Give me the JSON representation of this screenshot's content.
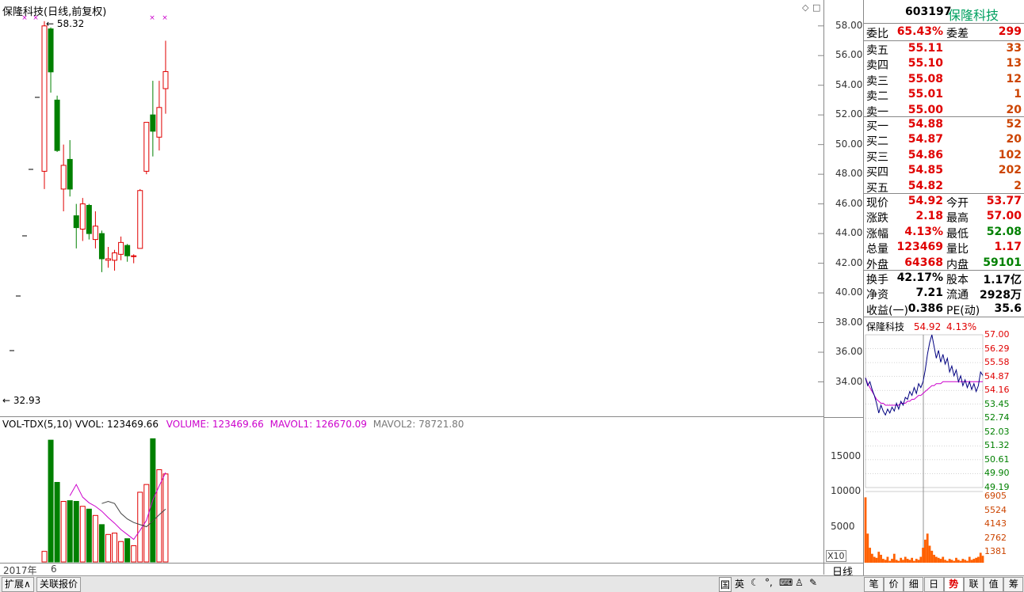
{
  "chart_header": {
    "title": "保隆科技(日线,前复权)",
    "high_marker": "58.32",
    "low_marker": "32.93"
  },
  "price_axis": [
    "58.00",
    "56.00",
    "54.00",
    "52.00",
    "50.00",
    "48.00",
    "46.00",
    "44.00",
    "42.00",
    "40.00",
    "38.00",
    "36.00",
    "34.00"
  ],
  "vol_header": {
    "name": "VOL-TDX(5,10)",
    "vvol": "VVOL: 123469.66",
    "volume": "VOLUME: 123469.66",
    "mavol1": "MAVOL1: 126670.09",
    "mavol2": "MAVOL2: 78721.80"
  },
  "vol_axis": [
    "15000",
    "10000",
    "5000"
  ],
  "vol_unit": "X10",
  "date_axis": {
    "year": "2017年",
    "month": "6"
  },
  "period_label": "日线",
  "colors": {
    "up": "#e00000",
    "down": "#008000",
    "vol_ma1": "#cc00cc",
    "vol_ma2": "#444444",
    "up_text": "#e00000",
    "down_text": "#008000"
  },
  "chart_data": {
    "type": "candlestick",
    "candles": [
      {
        "o": 48.2,
        "h": 58.32,
        "l": 47.0,
        "c": 58.0
      },
      {
        "o": 57.8,
        "h": 57.9,
        "l": 53.5,
        "c": 54.9
      },
      {
        "o": 53.0,
        "h": 53.3,
        "l": 49.5,
        "c": 49.6
      },
      {
        "o": 47.0,
        "h": 50.0,
        "l": 45.5,
        "c": 48.6
      },
      {
        "o": 49.0,
        "h": 50.3,
        "l": 46.5,
        "c": 47.0
      },
      {
        "o": 45.2,
        "h": 46.0,
        "l": 43.0,
        "c": 44.4
      },
      {
        "o": 44.3,
        "h": 46.4,
        "l": 43.5,
        "c": 46.0
      },
      {
        "o": 45.9,
        "h": 46.0,
        "l": 43.6,
        "c": 44.0
      },
      {
        "o": 43.6,
        "h": 45.5,
        "l": 43.0,
        "c": 44.5
      },
      {
        "o": 44.0,
        "h": 44.2,
        "l": 41.4,
        "c": 42.3
      },
      {
        "o": 42.2,
        "h": 43.1,
        "l": 41.7,
        "c": 42.3
      },
      {
        "o": 42.2,
        "h": 42.9,
        "l": 41.5,
        "c": 42.7
      },
      {
        "o": 42.6,
        "h": 43.8,
        "l": 42.2,
        "c": 43.4
      },
      {
        "o": 43.2,
        "h": 43.3,
        "l": 42.1,
        "c": 42.5
      },
      {
        "o": 42.5,
        "h": 42.6,
        "l": 42.0,
        "c": 42.5
      },
      {
        "o": 43.0,
        "h": 47.0,
        "l": 43.0,
        "c": 46.9
      },
      {
        "o": 48.2,
        "h": 51.5,
        "l": 48.0,
        "c": 51.5
      },
      {
        "o": 52.0,
        "h": 54.3,
        "l": 49.2,
        "c": 50.9
      },
      {
        "o": 50.5,
        "h": 54.3,
        "l": 49.6,
        "c": 52.5
      },
      {
        "o": 53.77,
        "h": 57.0,
        "l": 52.08,
        "c": 54.92
      }
    ],
    "volumes": [
      1500,
      17300,
      11300,
      8600,
      8700,
      8600,
      7900,
      7500,
      6600,
      5300,
      3900,
      4100,
      2900,
      3300,
      2300,
      9900,
      11000,
      17500,
      13100,
      12500
    ],
    "mavol1": [
      null,
      null,
      null,
      null,
      9400,
      11000,
      9200,
      8400,
      7900,
      7200,
      6300,
      5500,
      4600,
      3900,
      3200,
      4500,
      5900,
      8800,
      10800,
      12700
    ],
    "mavol2": [
      null,
      null,
      null,
      null,
      null,
      null,
      null,
      null,
      null,
      8300,
      8600,
      8300,
      6900,
      6100,
      5600,
      5300,
      5000,
      5800,
      6700,
      7500
    ],
    "ylim": [
      32.0,
      59.0
    ],
    "vol_ylim": [
      0,
      19000
    ]
  },
  "quote": {
    "code": "603197",
    "name": "保隆科技",
    "weibi_label": "委比",
    "weibi": "65.43%",
    "weicha_label": "委差",
    "weicha": "299",
    "sell": [
      {
        "label": "卖五",
        "price": "55.11",
        "vol": "33"
      },
      {
        "label": "卖四",
        "price": "55.10",
        "vol": "13"
      },
      {
        "label": "卖三",
        "price": "55.08",
        "vol": "12"
      },
      {
        "label": "卖二",
        "price": "55.01",
        "vol": "1"
      },
      {
        "label": "卖一",
        "price": "55.00",
        "vol": "20"
      }
    ],
    "buy": [
      {
        "label": "买一",
        "price": "54.88",
        "vol": "52"
      },
      {
        "label": "买二",
        "price": "54.87",
        "vol": "20"
      },
      {
        "label": "买三",
        "price": "54.86",
        "vol": "102"
      },
      {
        "label": "买四",
        "price": "54.85",
        "vol": "202"
      },
      {
        "label": "买五",
        "price": "54.82",
        "vol": "2"
      }
    ],
    "stats": [
      {
        "l1": "现价",
        "v1": "54.92",
        "c1": "red",
        "l2": "今开",
        "v2": "53.77",
        "c2": "red"
      },
      {
        "l1": "涨跌",
        "v1": "2.18",
        "c1": "red",
        "l2": "最高",
        "v2": "57.00",
        "c2": "red"
      },
      {
        "l1": "涨幅",
        "v1": "4.13%",
        "c1": "red",
        "l2": "最低",
        "v2": "52.08",
        "c2": "green"
      },
      {
        "l1": "总量",
        "v1": "123469",
        "c1": "red",
        "l2": "量比",
        "v2": "1.17",
        "c2": "red"
      },
      {
        "l1": "外盘",
        "v1": "64368",
        "c1": "red",
        "l2": "内盘",
        "v2": "59101",
        "c2": "green"
      }
    ],
    "fin": [
      {
        "l1": "换手",
        "v1": "42.17%",
        "l2": "股本",
        "v2": "1.17亿"
      },
      {
        "l1": "净资",
        "v1": "7.21",
        "l2": "流通",
        "v2": "2928万"
      },
      {
        "l1": "收益(一)",
        "v1": "0.386",
        "l2": "PE(动)",
        "v2": "35.6"
      }
    ]
  },
  "mini_chart": {
    "name": "保隆科技",
    "price": "54.92",
    "pct": "4.13%",
    "price_ticks": [
      "57.00",
      "56.29",
      "55.58",
      "54.87",
      "54.16",
      "53.45",
      "52.74",
      "52.03",
      "51.32",
      "50.61",
      "49.90",
      "49.19"
    ],
    "vol_ticks": [
      "6905",
      "5524",
      "4143",
      "2762",
      "1381"
    ],
    "price_series": [
      54.8,
      54.4,
      54.6,
      54.2,
      53.9,
      53.5,
      53.0,
      53.4,
      53.1,
      52.9,
      53.2,
      53.0,
      53.3,
      53.1,
      53.5,
      53.2,
      53.6,
      53.4,
      53.8,
      53.7,
      54.1,
      53.9,
      54.3,
      54.0,
      54.5,
      54.3,
      54.6,
      55.2,
      56.0,
      56.6,
      57.0,
      56.4,
      55.8,
      56.2,
      55.6,
      56.0,
      55.5,
      55.8,
      55.1,
      55.4,
      54.9,
      55.2,
      54.6,
      54.9,
      54.4,
      54.7,
      54.3,
      54.6,
      54.2,
      54.5,
      54.1,
      54.4,
      55.1,
      54.92
    ],
    "avg_series": [
      54.8,
      54.5,
      54.3,
      54.1,
      53.9,
      53.7,
      53.6,
      53.5,
      53.5,
      53.4,
      53.4,
      53.4,
      53.4,
      53.4,
      53.4,
      53.4,
      53.5,
      53.5,
      53.5,
      53.6,
      53.6,
      53.7,
      53.7,
      53.8,
      53.9,
      53.9,
      54.0,
      54.1,
      54.2,
      54.3,
      54.4,
      54.4,
      54.5,
      54.5,
      54.5,
      54.6,
      54.6,
      54.6,
      54.6,
      54.6,
      54.6,
      54.6,
      54.6,
      54.6,
      54.6,
      54.6,
      54.6,
      54.6,
      54.6,
      54.6,
      54.6,
      54.6,
      54.6,
      54.6
    ],
    "vol_series": [
      6800,
      3200,
      1800,
      1200,
      900,
      800,
      1400,
      1100,
      700,
      600,
      900,
      500,
      700,
      1200,
      600,
      500,
      800,
      600,
      900,
      700,
      600,
      800,
      500,
      700,
      600,
      900,
      1800,
      2600,
      3200,
      2000,
      1500,
      1100,
      900,
      800,
      700,
      900,
      600,
      500,
      700,
      600,
      500,
      800,
      600,
      500,
      700,
      600,
      500,
      900,
      600,
      700,
      800,
      900,
      1300,
      1000
    ]
  },
  "bottom_tabs": [
    "扩展∧",
    "关联报价"
  ],
  "bottom_right_tabs": [
    "笔",
    "价",
    "细",
    "日",
    "势",
    "联",
    "值",
    "筹"
  ],
  "tray_icons": [
    "国",
    "英"
  ],
  "toolbar_icons": [
    "diamond-icon",
    "square-icon"
  ]
}
